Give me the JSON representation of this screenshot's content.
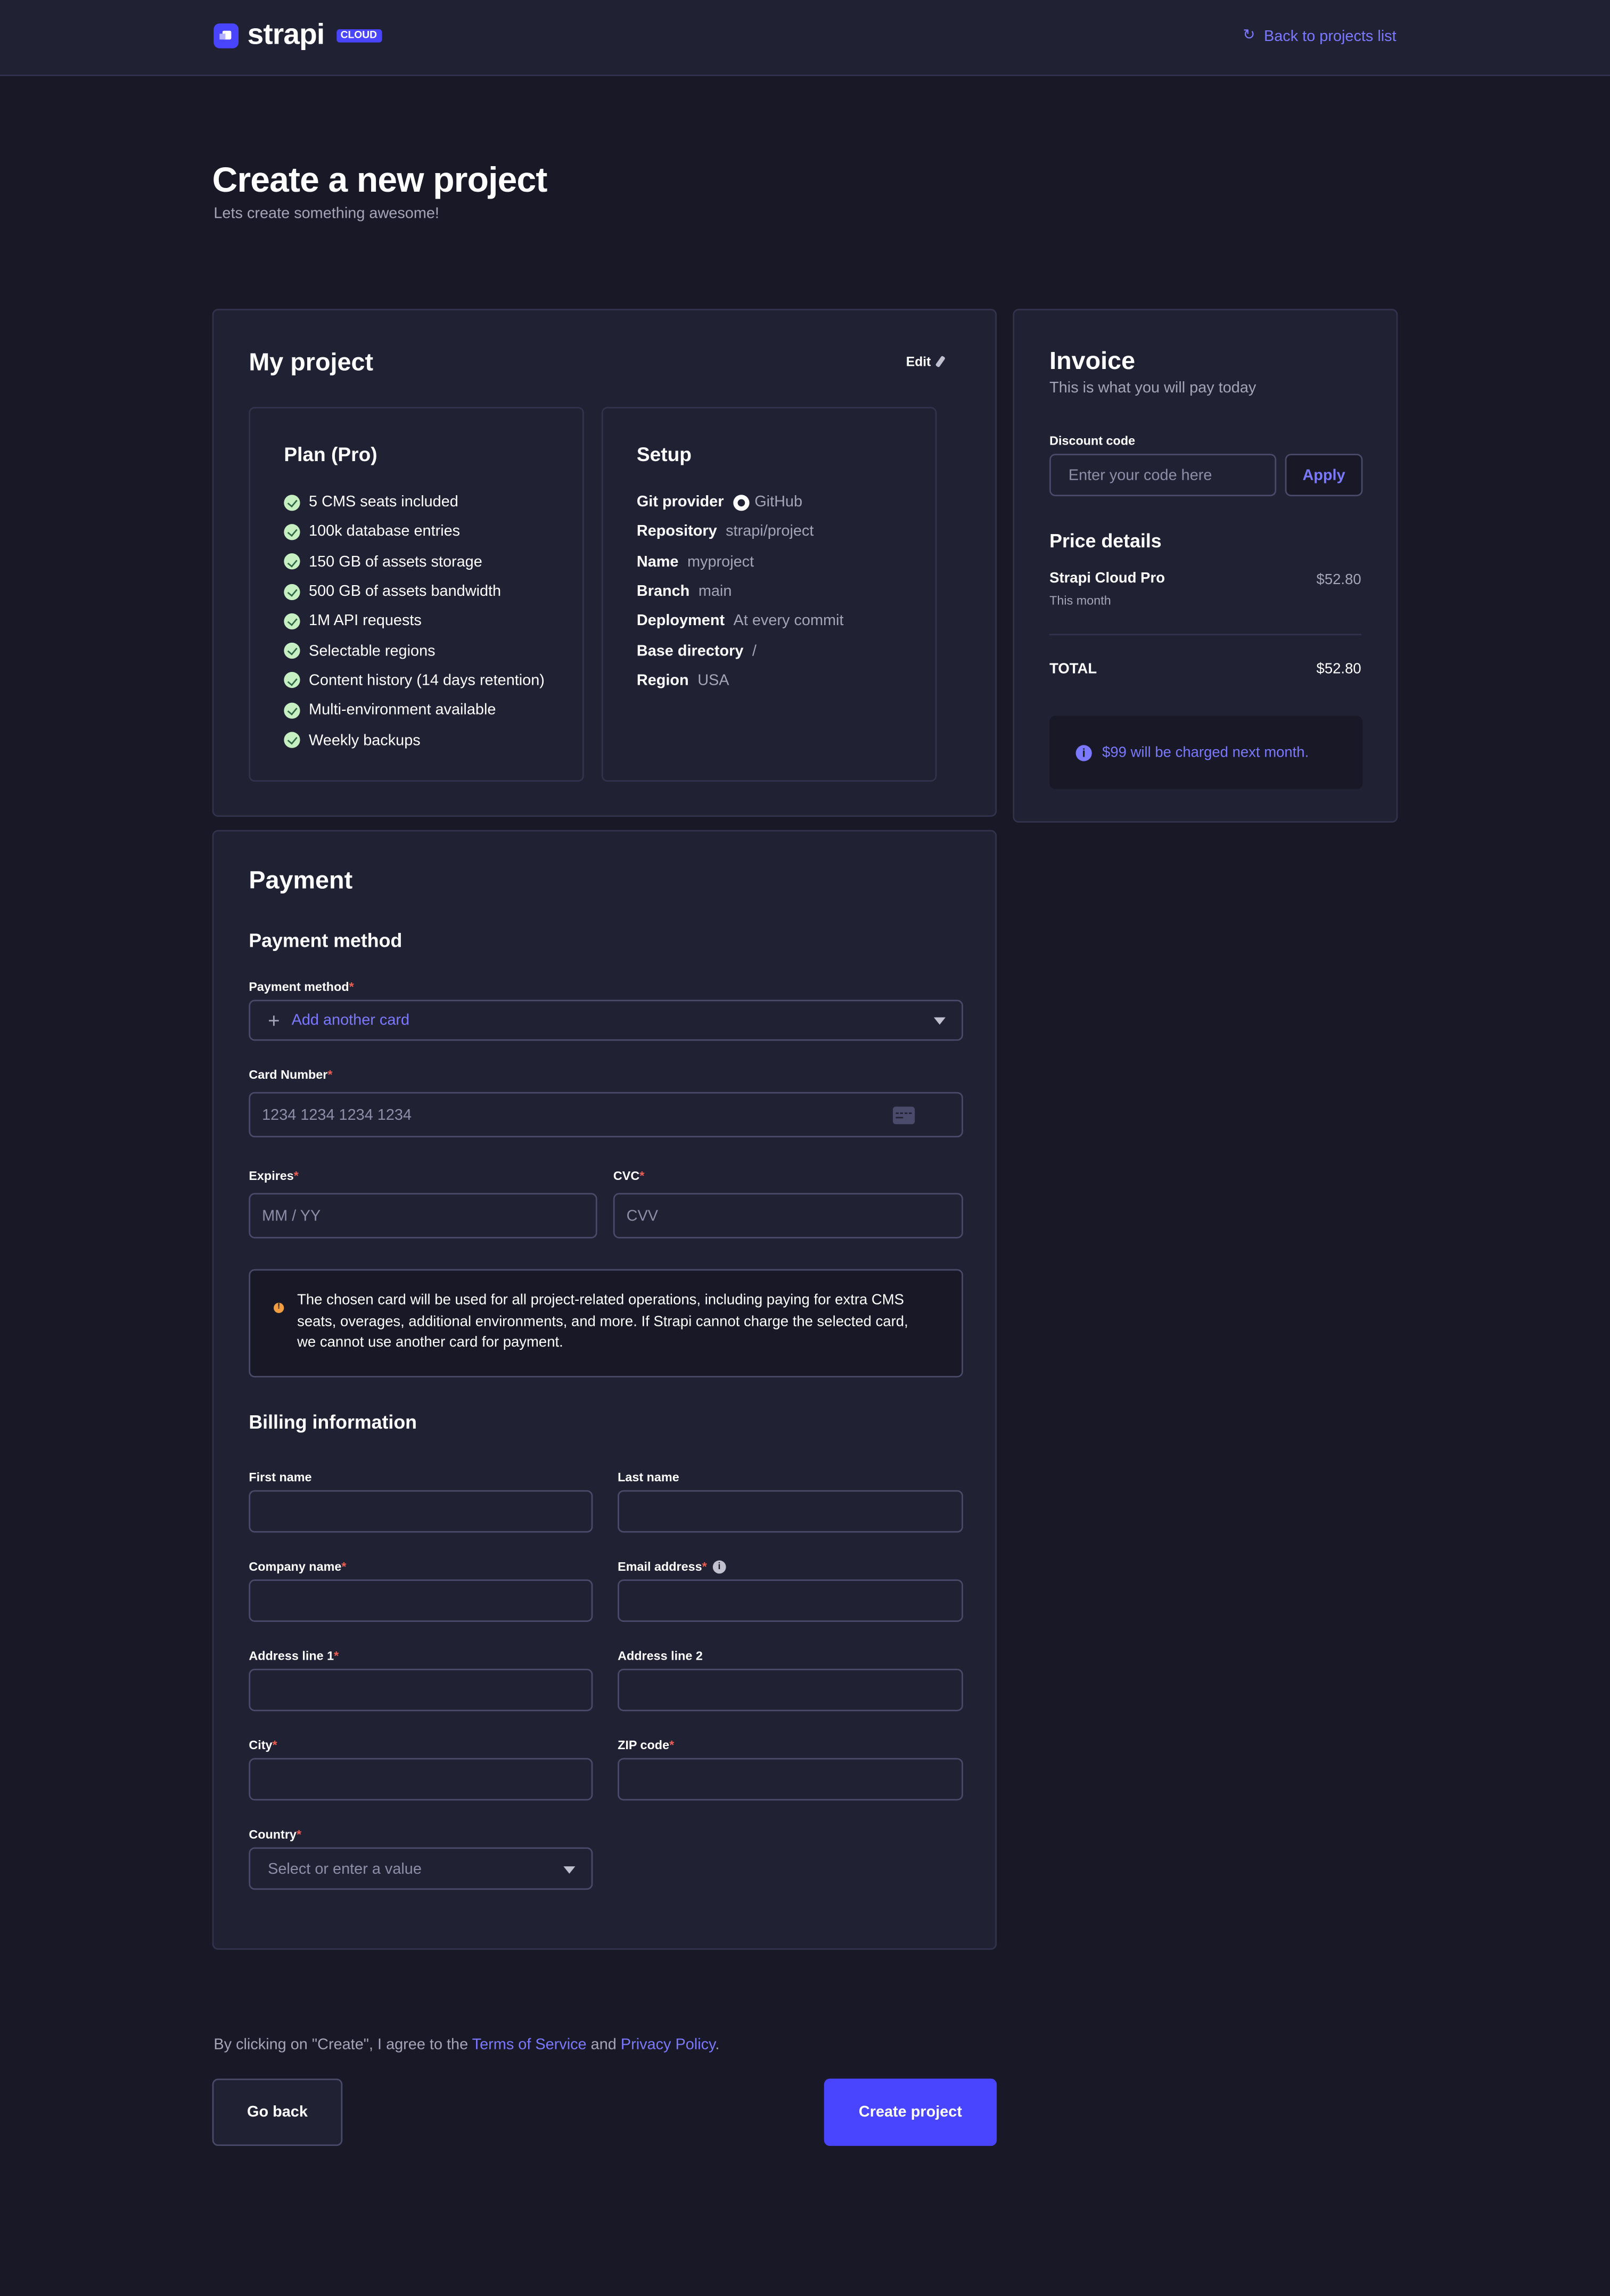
{
  "header": {
    "logo_text": "strapi",
    "logo_badge": "CLOUD",
    "back_link": "Back to projects list"
  },
  "page": {
    "title": "Create a new project",
    "subtitle": "Lets create something awesome!"
  },
  "project": {
    "title": "My project",
    "edit_label": "Edit",
    "plan": {
      "title": "Plan (Pro)",
      "features": [
        "5 CMS seats included",
        "100k database entries",
        "150 GB of assets storage",
        "500 GB of assets bandwidth",
        "1M API requests",
        "Selectable regions",
        "Content history (14 days retention)",
        "Multi-environment available",
        "Weekly backups"
      ]
    },
    "setup": {
      "title": "Setup",
      "rows": [
        {
          "key": "Git provider",
          "value": "GitHub",
          "icon": "github-icon"
        },
        {
          "key": "Repository",
          "value": "strapi/project"
        },
        {
          "key": "Name",
          "value": "myproject"
        },
        {
          "key": "Branch",
          "value": "main"
        },
        {
          "key": "Deployment",
          "value": "At every commit"
        },
        {
          "key": "Base directory",
          "value": "/"
        },
        {
          "key": "Region",
          "value": "USA"
        }
      ]
    }
  },
  "invoice": {
    "title": "Invoice",
    "subtitle": "This is what you will pay today",
    "discount_label": "Discount code",
    "discount_placeholder": "Enter your code here",
    "discount_value": "",
    "apply_label": "Apply",
    "price_details_title": "Price details",
    "item_name": "Strapi Cloud Pro",
    "item_period": "This month",
    "item_price": "$52.80",
    "total_label": "TOTAL",
    "total_value": "$52.80",
    "note": "$99 will be charged next month."
  },
  "payment": {
    "title": "Payment",
    "method_section": "Payment method",
    "method_label": "Payment method",
    "method_value": "Add another card",
    "card_number_label": "Card Number",
    "card_number_placeholder": "1234 1234 1234 1234",
    "expires_label": "Expires",
    "expires_placeholder": "MM / YY",
    "cvc_label": "CVC",
    "cvc_placeholder": "CVV",
    "warning": "The chosen card will be used for all project-related operations, including paying for extra CMS seats, overages, additional environments, and more. If Strapi cannot charge the selected card, we cannot use another card for payment.",
    "billing_section": "Billing information",
    "required_mark": "*",
    "fields": {
      "first_name": "First name",
      "last_name": "Last name",
      "company_name": "Company name",
      "email": "Email address",
      "address1": "Address line 1",
      "address2": "Address line 2",
      "city": "City",
      "zip": "ZIP code",
      "country": "Country",
      "country_placeholder": "Select or enter a value"
    }
  },
  "footer": {
    "terms_prefix": "By clicking on \"Create\", I agree to the ",
    "terms_link": "Terms of Service",
    "terms_and": " and ",
    "privacy_link": "Privacy Policy",
    "terms_suffix": ".",
    "go_back": "Go back",
    "create": "Create project"
  },
  "colors": {
    "accent": "#4945ff",
    "link": "#7b79ff",
    "background": "#181826",
    "surface": "#212134",
    "required": "#ee5e52",
    "warning": "#f29d41",
    "success_check": "#c6f0c2"
  }
}
